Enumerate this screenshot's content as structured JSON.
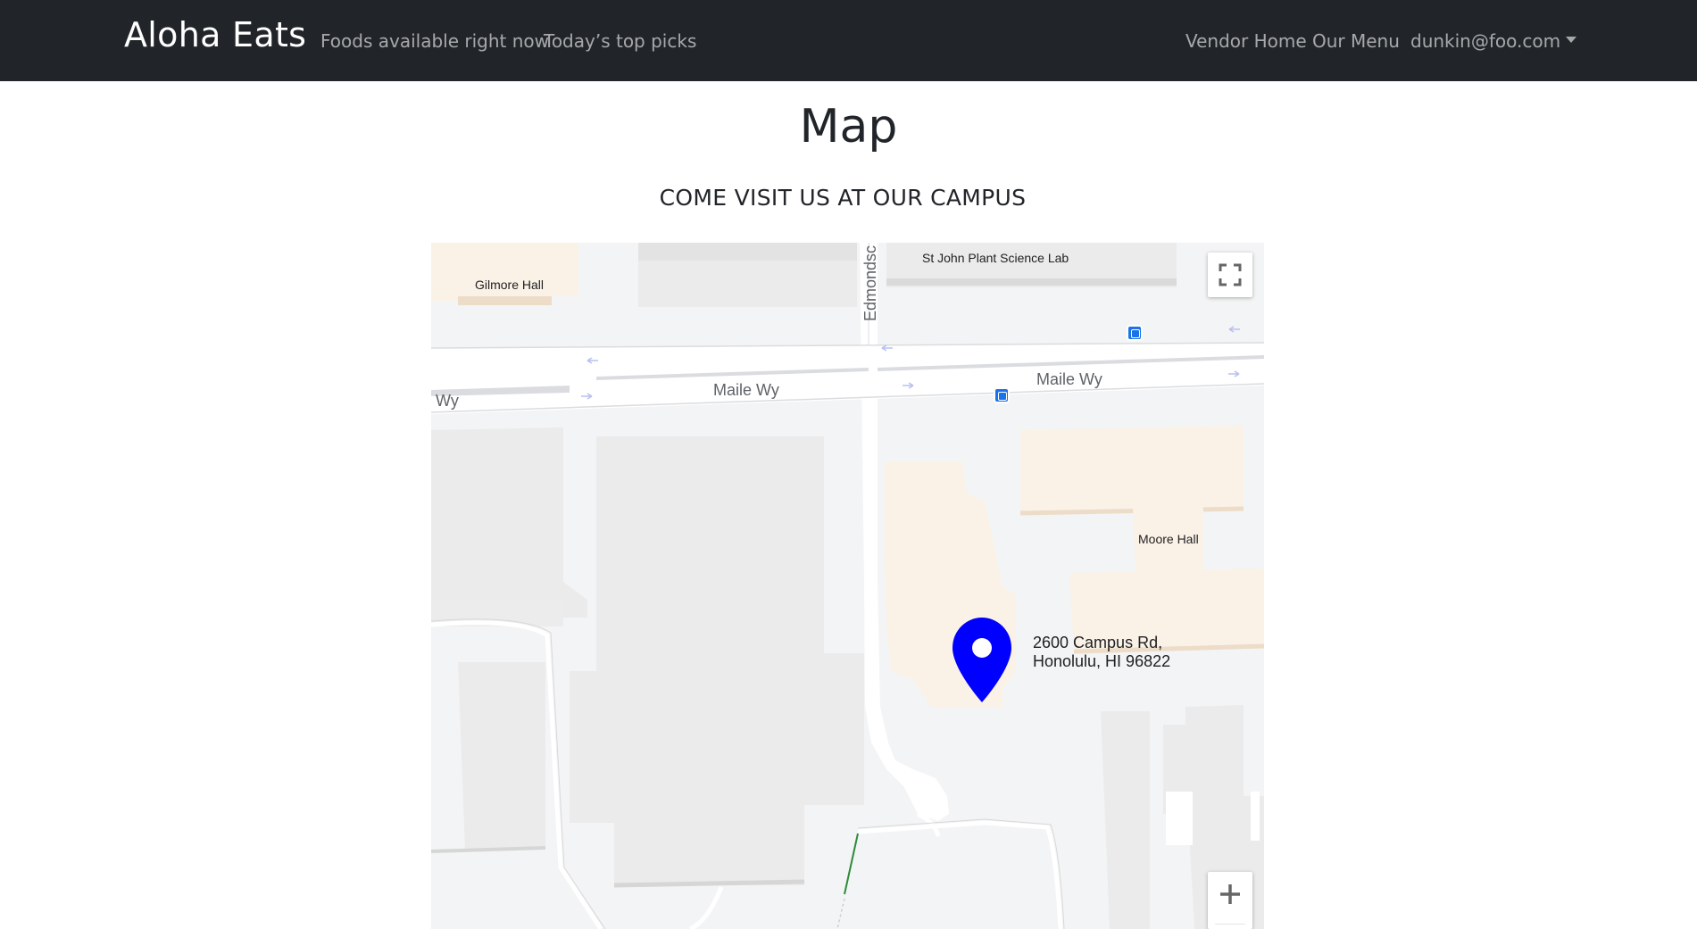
{
  "navbar": {
    "brand": "Aloha Eats",
    "left_links": [
      "Foods available right now",
      "Today’s top picks"
    ],
    "right_links": [
      "Vendor Home",
      "Our Menu"
    ],
    "user_menu": "dunkin@foo.com"
  },
  "page": {
    "title": "Map",
    "subtitle": "COME VISIT US AT OUR CAMPUS"
  },
  "map": {
    "place_labels": {
      "gilmore": "Gilmore Hall",
      "plant_lab": "St John Plant Science Lab",
      "moore": "Moore Hall"
    },
    "road_labels": {
      "maile_left": "Maile Wy",
      "maile_right": "Maile Wy",
      "wy_edge": "Wy",
      "edmondson": "Edmondsc"
    },
    "address_line1": "2600 Campus Rd,",
    "address_line2": "Honolulu, HI 96822",
    "marker_color": "#0000ff",
    "controls": {
      "fullscreen_icon": "fullscreen-icon",
      "zoom_in_icon": "plus-icon"
    }
  }
}
